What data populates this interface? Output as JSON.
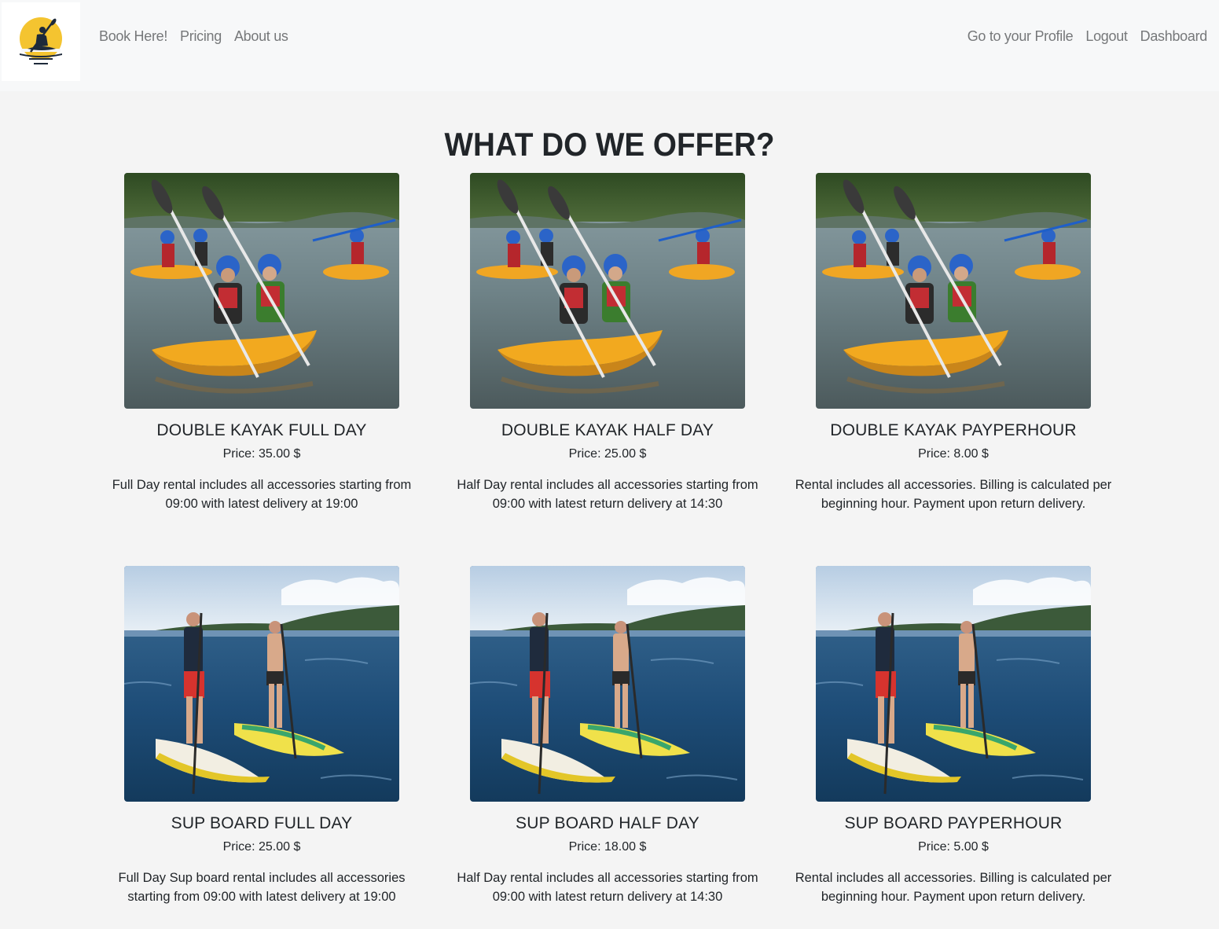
{
  "nav": {
    "left_links": [
      "Book Here!",
      "Pricing",
      "About us"
    ],
    "right_links": [
      "Go to your Profile",
      "Logout",
      "Dashboard"
    ]
  },
  "logo": {
    "icon": "kayaker-sunset-logo-icon",
    "colors": {
      "sun": "#f4c430",
      "figure": "#1e2a3a"
    }
  },
  "main": {
    "title": "WHAT DO WE OFFER?"
  },
  "offers": [
    {
      "title": "DOUBLE KAYAK FULL DAY",
      "price": "Price: 35.00 $",
      "description": "Full Day rental includes all accessories starting from 09:00 with latest delivery at 19:00",
      "image": "double-kayak-photo"
    },
    {
      "title": "DOUBLE KAYAK HALF DAY",
      "price": "Price: 25.00 $",
      "description": "Half Day rental includes all accessories starting from 09:00 with latest return delivery at 14:30",
      "image": "double-kayak-photo"
    },
    {
      "title": "DOUBLE KAYAK PAYPERHOUR",
      "price": "Price: 8.00 $",
      "description": "Rental includes all accessories. Billing is calculated per beginning hour. Payment upon return delivery.",
      "image": "double-kayak-photo"
    },
    {
      "title": "SUP BOARD FULL DAY",
      "price": "Price: 25.00 $",
      "description": "Full Day Sup board rental includes all accessories starting from 09:00 with latest delivery at 19:00",
      "image": "sup-board-photo"
    },
    {
      "title": "SUP BOARD HALF DAY",
      "price": "Price: 18.00 $",
      "description": "Half Day rental includes all accessories starting from 09:00 with latest return delivery at 14:30",
      "image": "sup-board-photo"
    },
    {
      "title": "SUP BOARD PAYPERHOUR",
      "price": "Price: 5.00 $",
      "description": "Rental includes all accessories. Billing is calculated per beginning hour. Payment upon return delivery.",
      "image": "sup-board-photo"
    }
  ]
}
